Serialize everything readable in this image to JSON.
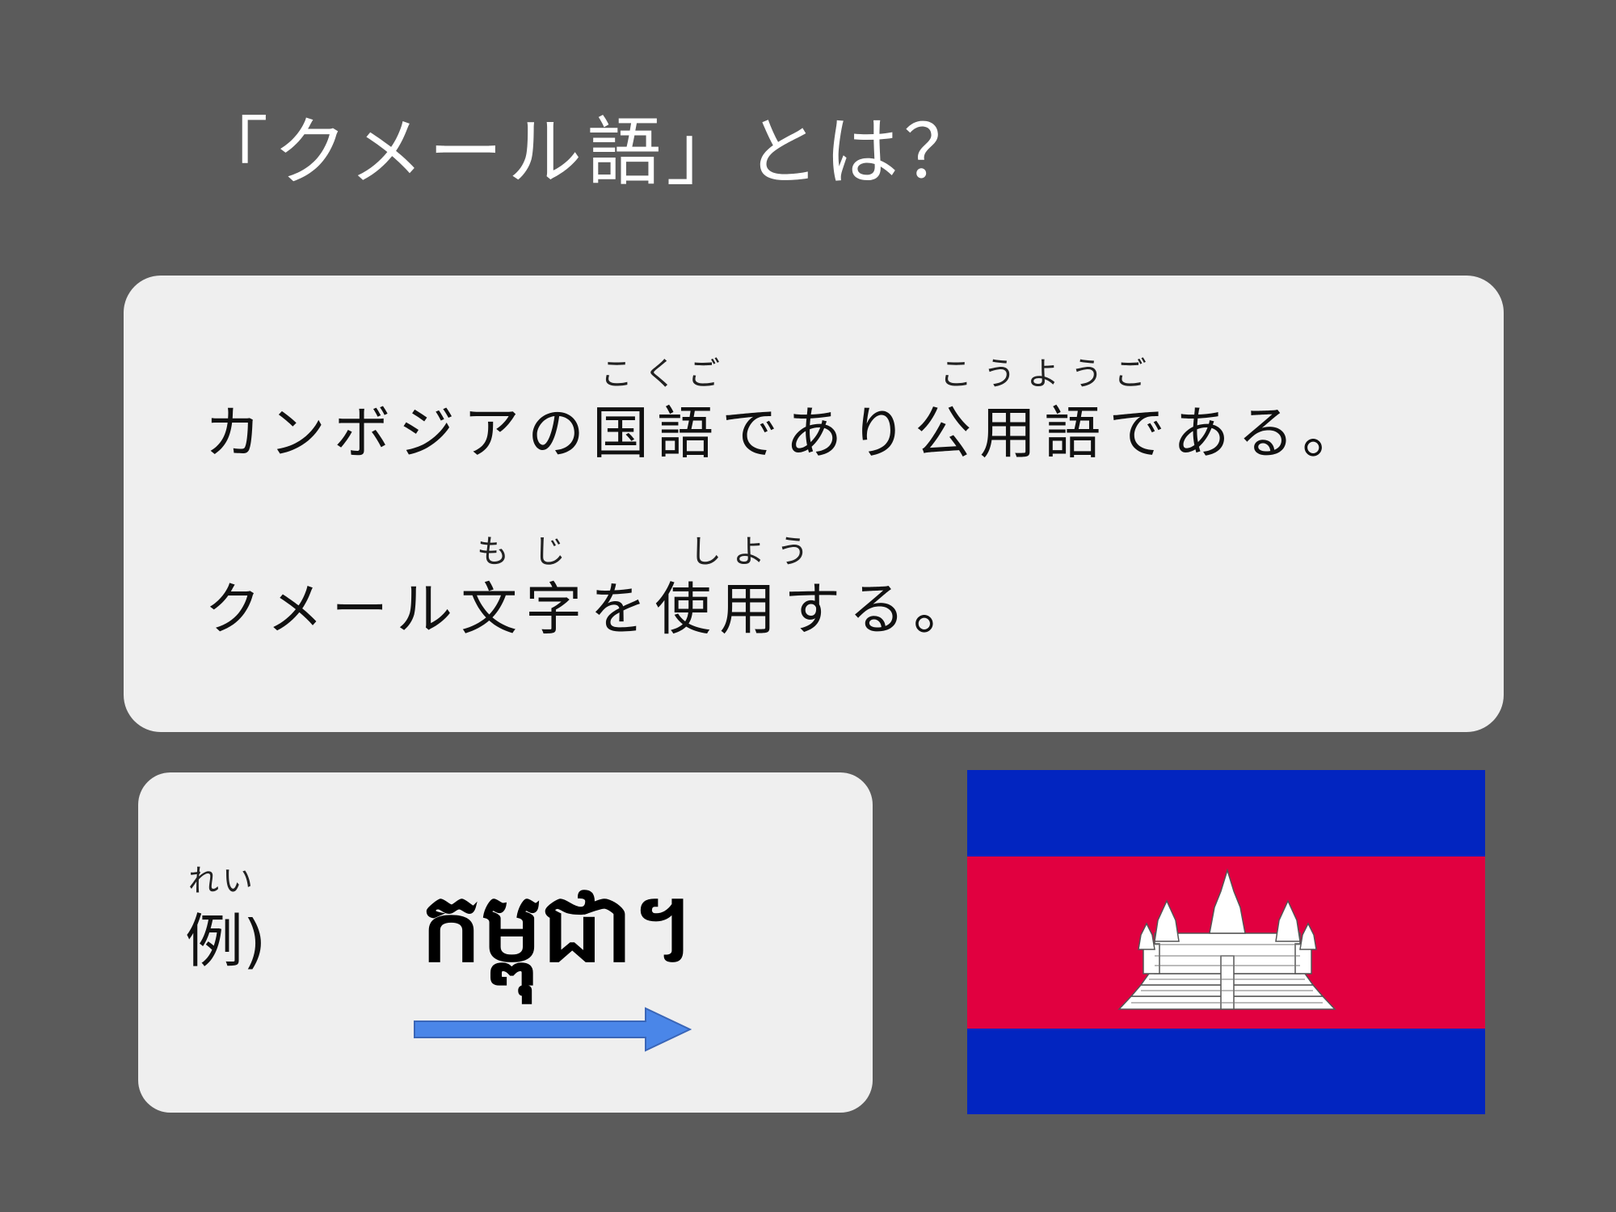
{
  "slide": {
    "title": "「クメール語」とは？"
  },
  "description": {
    "line1": {
      "text": "カンボジアの国語であり公用語である。",
      "ruby_kokugo": "こくご",
      "ruby_kouyougo": "こうようご"
    },
    "line2": {
      "text": "クメール文字を使用する。",
      "ruby_moji": "もじ",
      "ruby_shiyou": "しよう"
    }
  },
  "example": {
    "ruby": "れい",
    "label": "例)",
    "khmer_text": "កម្ពុជា។",
    "arrow_color": "#4a86e8"
  },
  "flag": {
    "colors": {
      "blue": "#0225c0",
      "red": "#e10040",
      "temple": "#ffffff"
    },
    "icon": "cambodia-flag-angkor-wat"
  }
}
